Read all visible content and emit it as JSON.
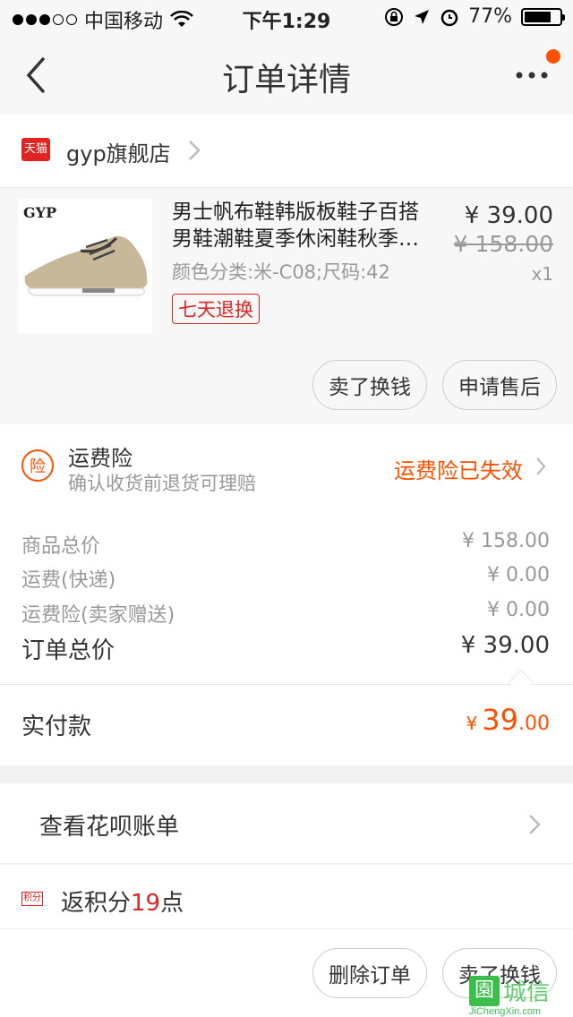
{
  "status_bar": {
    "carrier": "中国移动",
    "time": "下午1:29",
    "battery": "77%",
    "battery_level": 0.77
  },
  "nav": {
    "title": "订单详情"
  },
  "shop": {
    "badge": "天猫",
    "name": "gyp旗舰店"
  },
  "product": {
    "thumb_brand": "GYP",
    "title_line1": "男士帆布鞋韩版板鞋子百搭",
    "title_line2": "男鞋潮鞋夏季休闲鞋秋季…",
    "spec": "颜色分类:米-C08;尺码:42",
    "tag": "七天退换",
    "price": "¥ 39.00",
    "original_price": "¥ 158.00",
    "quantity": "x1",
    "sell_button": "卖了换钱",
    "aftersale_button": "申请售后"
  },
  "insurance": {
    "icon_char": "险",
    "title": "运费险",
    "description": "确认收货前退货可理赔",
    "status": "运费险已失效"
  },
  "summary": {
    "rows": [
      {
        "label": "商品总价",
        "value": "¥ 158.00"
      },
      {
        "label": "运费(快递)",
        "value": "¥ 0.00"
      },
      {
        "label": "运费险(卖家赠送)",
        "value": "¥ 0.00"
      }
    ],
    "total_label": "订单总价",
    "total_value": "¥ 39.00"
  },
  "paid": {
    "label": "实付款",
    "currency": "¥",
    "integer": "39",
    "decimal": ".00"
  },
  "huabei": {
    "label": "查看花呗账单"
  },
  "points": {
    "icon": "积分",
    "prefix": "返积分",
    "number": "19",
    "suffix": "点"
  },
  "footer": {
    "delete_button": "删除订单",
    "sell_button": "卖了换钱"
  },
  "watermark": {
    "char": "園",
    "text": "城信",
    "site": "JiChengXin.com"
  },
  "colors": {
    "accent": "#ff5000",
    "tmall_red": "#e02424",
    "watermark_green": "#3cbf4a"
  }
}
